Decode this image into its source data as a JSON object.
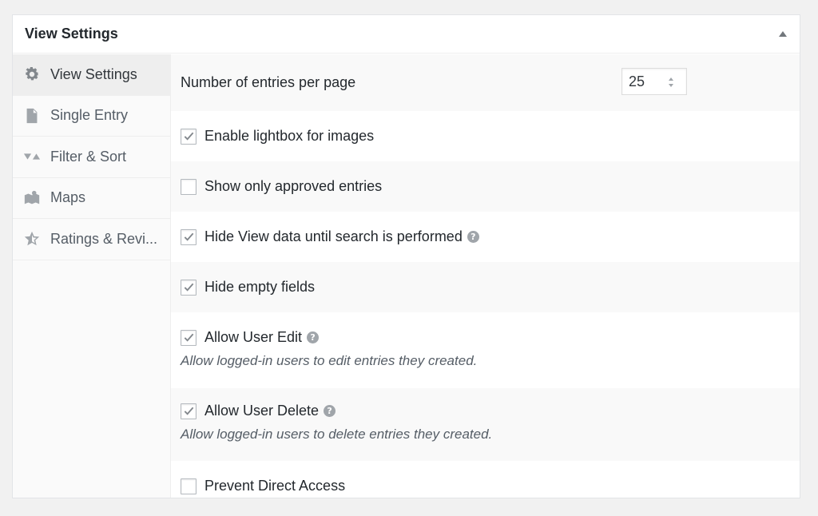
{
  "postbox": {
    "title": "View Settings"
  },
  "tabs": [
    {
      "label": "View Settings",
      "icon": "gear-icon",
      "active": true
    },
    {
      "label": "Single Entry",
      "icon": "document-icon",
      "active": false
    },
    {
      "label": "Filter & Sort",
      "icon": "filter-sort-icon",
      "active": false
    },
    {
      "label": "Maps",
      "icon": "map-icon",
      "active": false
    },
    {
      "label": "Ratings & Revi...",
      "icon": "star-icon",
      "active": false
    }
  ],
  "settings": {
    "entries_per_page": {
      "label": "Number of entries per page",
      "value": "25"
    },
    "lightbox": {
      "label": "Enable lightbox for images",
      "checked": true
    },
    "approved_only": {
      "label": "Show only approved entries",
      "checked": false
    },
    "hide_until_search": {
      "label": "Hide View data until search is performed",
      "checked": true,
      "help": "?"
    },
    "hide_empty": {
      "label": "Hide empty fields",
      "checked": true
    },
    "user_edit": {
      "label": "Allow User Edit",
      "checked": true,
      "help": "?",
      "description": "Allow logged-in users to edit entries they created."
    },
    "user_delete": {
      "label": "Allow User Delete",
      "checked": true,
      "help": "?",
      "description": "Allow logged-in users to delete entries they created."
    },
    "direct_access": {
      "label": "Prevent Direct Access",
      "checked": false
    }
  },
  "colors": {
    "checkmark": "#82878c",
    "accent_text": "#23282d"
  }
}
